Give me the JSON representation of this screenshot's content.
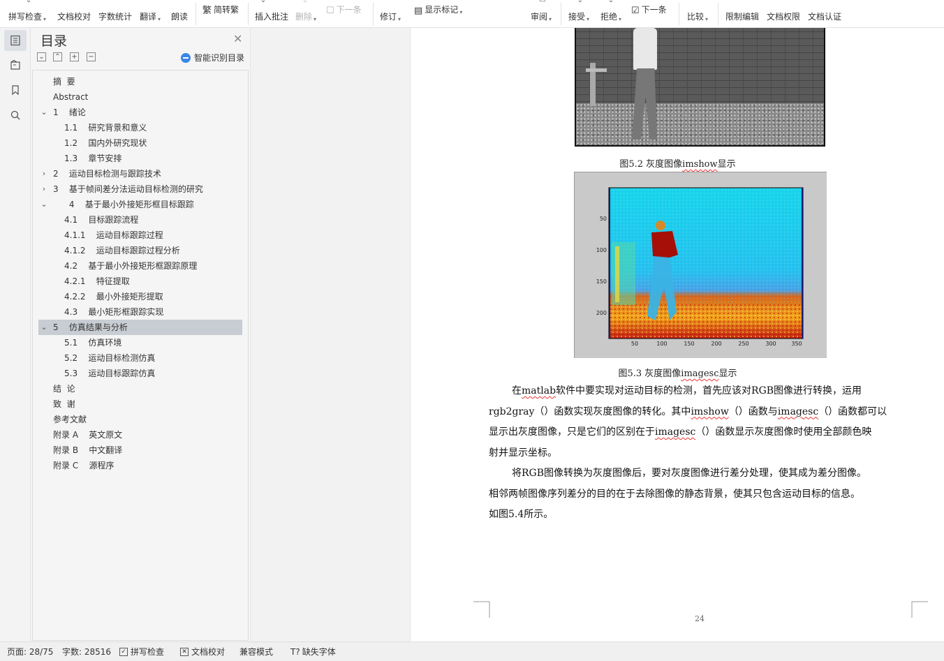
{
  "ribbon": {
    "spell_check": "拼写检查",
    "doc_proofread": "文档校对",
    "word_count": "字数统计",
    "translate": "翻译",
    "read_aloud": "朗读",
    "trad_simp": "简转繁",
    "insert_comment": "插入批注",
    "delete": "删除",
    "next_comment": "下一条",
    "revise": "修订",
    "show_marks": "显示标记",
    "review": "审阅",
    "accept": "接受",
    "reject": "拒绝",
    "next_change": "下一条",
    "compare": "比较",
    "restrict_edit": "限制编辑",
    "doc_rights": "文档权限",
    "doc_cert": "文档认证"
  },
  "toc": {
    "title": "目录",
    "smart_label": "智能识别目录",
    "items": [
      {
        "label": "摘  要",
        "level": 0,
        "chev": ""
      },
      {
        "label": "Abstract",
        "level": 0,
        "chev": ""
      },
      {
        "label": "1    绪论",
        "level": 0,
        "chev": "v"
      },
      {
        "label": "1.1    研究背景和意义",
        "level": 1,
        "chev": ""
      },
      {
        "label": "1.2    国内外研究现状",
        "level": 1,
        "chev": ""
      },
      {
        "label": "1.3    章节安排",
        "level": 1,
        "chev": ""
      },
      {
        "label": "2    运动目标检测与跟踪技术",
        "level": 0,
        "chev": ">"
      },
      {
        "label": "3    基于帧间差分法运动目标检测的研究",
        "level": 0,
        "chev": ">"
      },
      {
        "label": "      4    基于最小外接矩形框目标跟踪",
        "level": 0,
        "chev": "v"
      },
      {
        "label": "4.1    目标跟踪流程",
        "level": 1,
        "chev": ""
      },
      {
        "label": "4.1.1    运动目标跟踪过程",
        "level": 1,
        "chev": ""
      },
      {
        "label": "4.1.2    运动目标跟踪过程分析",
        "level": 1,
        "chev": ""
      },
      {
        "label": "4.2    基于最小外接矩形框跟踪原理",
        "level": 1,
        "chev": ""
      },
      {
        "label": "4.2.1    特征提取",
        "level": 1,
        "chev": ""
      },
      {
        "label": "4.2.2    最小外接矩形提取",
        "level": 1,
        "chev": ""
      },
      {
        "label": "4.3    最小矩形框跟踪实现",
        "level": 1,
        "chev": ""
      },
      {
        "label": "5    仿真结果与分析",
        "level": 0,
        "chev": "v",
        "selected": true
      },
      {
        "label": "5.1    仿真环境",
        "level": 1,
        "chev": ""
      },
      {
        "label": "5.2    运动目标检测仿真",
        "level": 1,
        "chev": ""
      },
      {
        "label": "5.3    运动目标跟踪仿真",
        "level": 1,
        "chev": ""
      },
      {
        "label": "结  论",
        "level": 0,
        "chev": ""
      },
      {
        "label": "致  谢",
        "level": 0,
        "chev": ""
      },
      {
        "label": "参考文献",
        "level": 0,
        "chev": ""
      },
      {
        "label": "附录 A    英文原文",
        "level": 0,
        "chev": ""
      },
      {
        "label": "附录 B    中文翻译",
        "level": 0,
        "chev": ""
      },
      {
        "label": "附录 C    源程序",
        "level": 0,
        "chev": ""
      }
    ]
  },
  "document": {
    "fig2_caption_a": "图5.2  灰度图像",
    "fig2_caption_b": "imshow",
    "fig2_caption_c": "显示",
    "fig3_caption_a": "图5.3  灰度图像",
    "fig3_caption_b": "imagesc",
    "fig3_caption_c": "显示",
    "fig3_yticks": [
      "50",
      "100",
      "150",
      "200"
    ],
    "fig3_xticks": [
      "50",
      "100",
      "150",
      "200",
      "250",
      "300",
      "350"
    ],
    "p1": {
      "l1a": "在",
      "l1b": "matlab",
      "l1c": "软件中要实现对运动目标的检测，首先应该对RGB图像进行转换，运用",
      "l2a": "rgb2gray（）函数实现灰度图像的转化。其中",
      "l2b": "imshow",
      "l2c": "（）函数与",
      "l2d": "imagesc",
      "l2e": "（）函数都可以",
      "l3a": "显示出灰度图像，只是它们的区别在于",
      "l3b": "imagesc",
      "l3c": "（）函数显示灰度图像时使用全部颜色映",
      "l4": "射并显示坐标。"
    },
    "p2": {
      "l1": "将RGB图像转换为灰度图像后，要对灰度图像进行差分处理，使其成为差分图像。",
      "l2": "相邻两帧图像序列差分的目的在于去除图像的静态背景，使其只包含运动目标的信息。",
      "l3": "如图5.4所示。"
    },
    "page_number": "24"
  },
  "status": {
    "page": "页面: 28/75",
    "words": "字数: 28516",
    "spell": "拼写检查",
    "proof": "文档校对",
    "compat": "兼容模式",
    "missing_font": "缺失字体"
  },
  "colors": {
    "accent": "#3b86e6",
    "selected_row": "#c8cdd3",
    "squiggle": "#e33333"
  }
}
